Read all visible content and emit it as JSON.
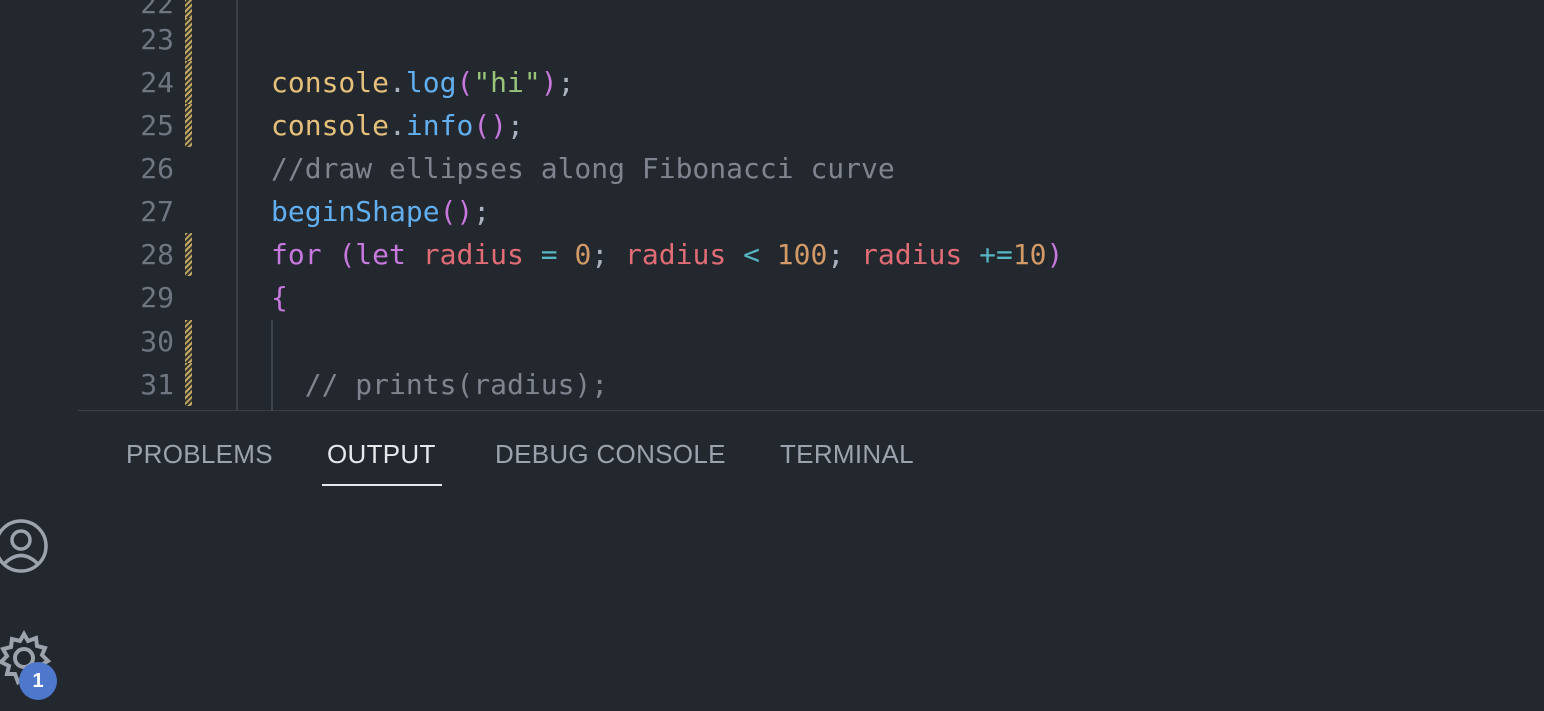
{
  "editor": {
    "lines": [
      {
        "num": "22",
        "tokens": []
      },
      {
        "num": "23",
        "tokens": []
      },
      {
        "num": "24",
        "tokens": [
          {
            "t": "console",
            "c": "obj"
          },
          {
            "t": ".",
            "c": "pun"
          },
          {
            "t": "log",
            "c": "fn"
          },
          {
            "t": "(",
            "c": "br"
          },
          {
            "t": "\"hi\"",
            "c": "str"
          },
          {
            "t": ")",
            "c": "br"
          },
          {
            "t": ";",
            "c": "pun"
          }
        ]
      },
      {
        "num": "25",
        "tokens": [
          {
            "t": "console",
            "c": "obj"
          },
          {
            "t": ".",
            "c": "pun"
          },
          {
            "t": "info",
            "c": "fn"
          },
          {
            "t": "()",
            "c": "br"
          },
          {
            "t": ";",
            "c": "pun"
          }
        ]
      },
      {
        "num": "26",
        "tokens": [
          {
            "t": "//draw ellipses along Fibonacci curve",
            "c": "com"
          }
        ]
      },
      {
        "num": "27",
        "tokens": [
          {
            "t": "beginShape",
            "c": "fn"
          },
          {
            "t": "()",
            "c": "br"
          },
          {
            "t": ";",
            "c": "pun"
          }
        ]
      },
      {
        "num": "28",
        "tokens": [
          {
            "t": "for ",
            "c": "kw"
          },
          {
            "t": "(",
            "c": "br"
          },
          {
            "t": "let ",
            "c": "kw"
          },
          {
            "t": "radius ",
            "c": "var"
          },
          {
            "t": "= ",
            "c": "op"
          },
          {
            "t": "0",
            "c": "num"
          },
          {
            "t": "; ",
            "c": "pun"
          },
          {
            "t": "radius ",
            "c": "var"
          },
          {
            "t": "< ",
            "c": "op"
          },
          {
            "t": "100",
            "c": "num"
          },
          {
            "t": "; ",
            "c": "pun"
          },
          {
            "t": "radius ",
            "c": "var"
          },
          {
            "t": "+=",
            "c": "op"
          },
          {
            "t": "10",
            "c": "num"
          },
          {
            "t": ")",
            "c": "br"
          }
        ]
      },
      {
        "num": "29",
        "tokens": [
          {
            "t": "{",
            "c": "br"
          }
        ]
      },
      {
        "num": "30",
        "tokens": []
      },
      {
        "num": "31",
        "tokens": [
          {
            "t": "  // prints(radius);",
            "c": "com"
          }
        ]
      }
    ]
  },
  "panel": {
    "tabs": [
      {
        "label": "PROBLEMS",
        "active": false
      },
      {
        "label": "OUTPUT",
        "active": true
      },
      {
        "label": "DEBUG CONSOLE",
        "active": false
      },
      {
        "label": "TERMINAL",
        "active": false
      }
    ]
  },
  "activity_bar": {
    "account_icon": "account-icon",
    "settings_icon": "gear-icon",
    "settings_badge": "1"
  },
  "colors": {
    "background": "#23272e",
    "badge": "#4d78cc",
    "modified_gutter": "#c3a76a"
  }
}
